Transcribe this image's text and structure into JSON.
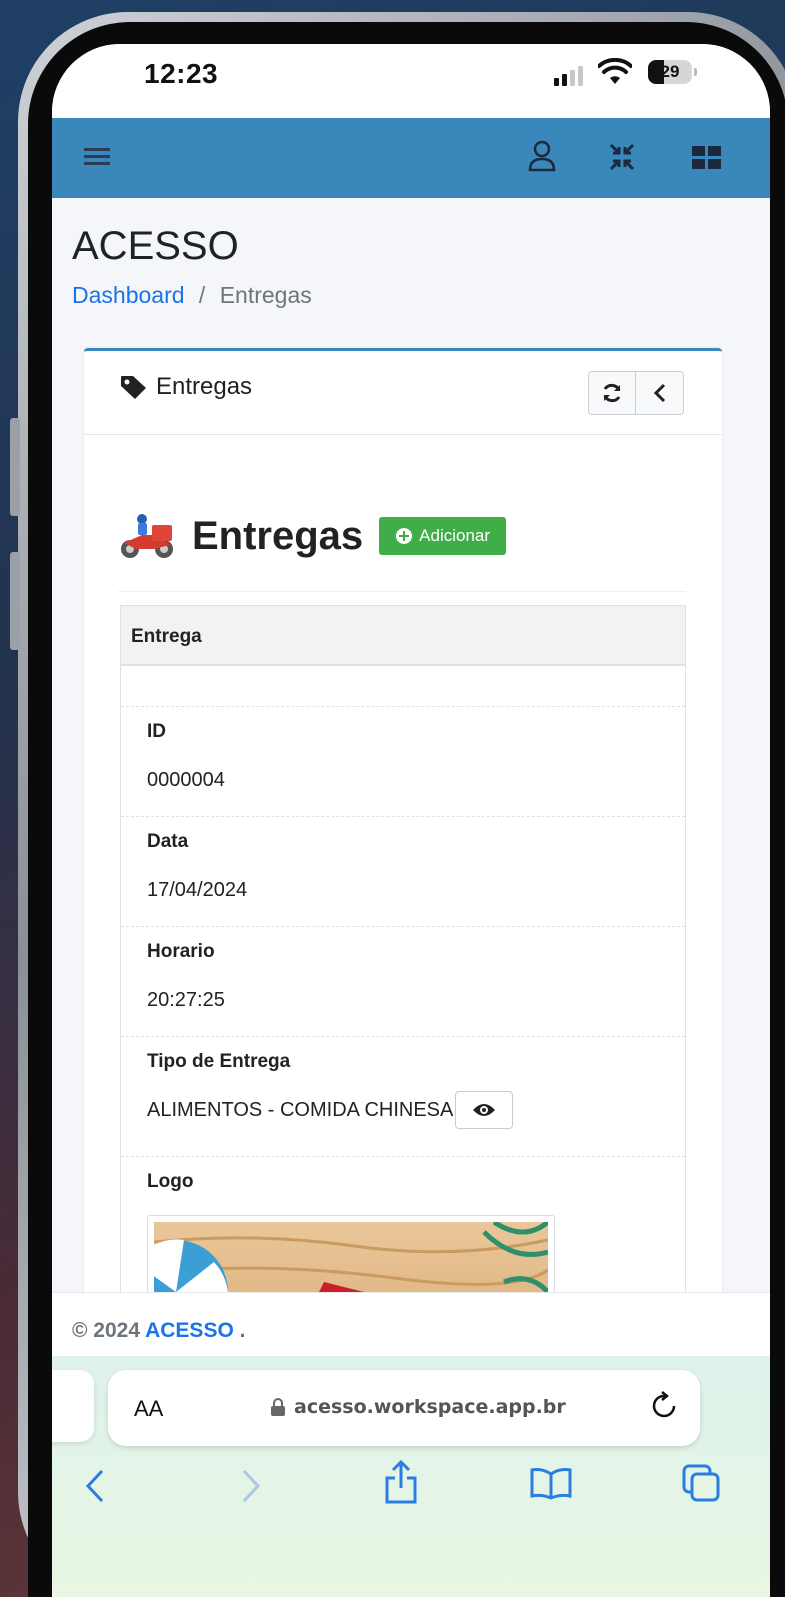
{
  "status_bar": {
    "time": "12:23",
    "battery": "29"
  },
  "navbar": {
    "icons": [
      "menu-icon",
      "user-icon",
      "compress-icon",
      "grid-icon"
    ]
  },
  "page": {
    "title": "ACESSO",
    "breadcrumb": {
      "home": "Dashboard",
      "separator": "/",
      "current": "Entregas"
    }
  },
  "card": {
    "title": "Entregas",
    "section_title": "Entregas",
    "add_button": "Adicionar",
    "table_header": "Entrega",
    "rows": [
      {
        "label": "ID",
        "value": "0000004"
      },
      {
        "label": "Data",
        "value": "17/04/2024"
      },
      {
        "label": "Horario",
        "value": "20:27:25"
      },
      {
        "label": "Tipo de Entrega",
        "value": "ALIMENTOS - COMIDA CHINESA"
      }
    ],
    "logo_label": "Logo"
  },
  "footer": {
    "copyright": "© 2024",
    "brand": "ACESSO",
    "suffix": "."
  },
  "safari": {
    "aa": "AA",
    "url": "acesso.workspace.app.br"
  },
  "colors": {
    "navbar": "#3a87bb",
    "add_button": "#3fae49",
    "link": "#1a73e8"
  }
}
